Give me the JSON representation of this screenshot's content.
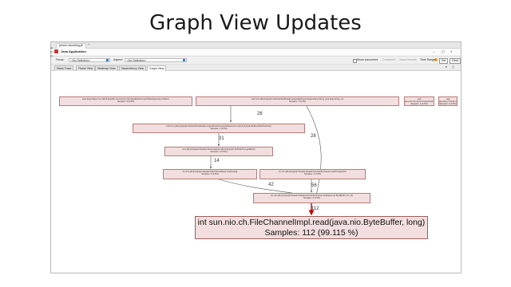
{
  "slide": {
    "title": "Graph View Updates"
  },
  "app": {
    "tab_title": "jvmcrc-recording.jfr",
    "tab_new": "+",
    "name": "Java Application",
    "window_controls": [
      "–",
      "▢",
      "×"
    ],
    "toolbar": {
      "focus_label": "Focus:",
      "focus_value": "<No Selection>",
      "aspect_label": "Aspect:",
      "aspect_value": "<No Selection>",
      "show_concurrent_label": "Show concurrent",
      "contained_label": "Contained",
      "same_threads_label": "Same threads",
      "time_range_label": "Time Range",
      "set_label": "Set",
      "clear_label": "Clear"
    },
    "view_tabs": [
      "Stack Trace",
      "Flame View",
      "Heatmap View",
      "Dependency View",
      "Graph View"
    ],
    "colors": {
      "node_fill": "#f2dede",
      "node_border": "#b97a7a",
      "highlight": "#c00000"
    }
  },
  "graph": {
    "nodes": [
      {
        "label": "java.lang.Object com.jdk.jfr.jfrgraph.concurrency.SimpleHttpServer.getObject(java.lang.Object)",
        "samples": "Samples: 3 (0.9%)"
      },
      {
        "label": "void com.jdk.jfr.jfrgraph.NetworkTextReader.writeHttpResponse(java.lang.String, java.lang.String, int)",
        "samples": "Samples: 1 (0.4%)"
      },
      {
        "label": "void java.util.concurrent.FutureTask.run()",
        "samples": "Samples: 2 (0.5%)"
      },
      {
        "label": "void java.lang.Thread.run()",
        "samples": "Samples: 2 (0.5%)"
      },
      {
        "label": "void com.jdk.jfr.jfrgraph.NetworkTextReader.LogicalTextProcessorWorker(com.jdk.jfr.jfrgraph.BufferedTextSubTree)",
        "samples": "Samples: 3 (0.9%)"
      },
      {
        "label": "com.jdk.jfr.jfrgraph.Reader.Slow.read(com.jdk.jfr.jfrgraph.TextSubTree.getBlock)",
        "samples": "Samples: 2 (0.6%)"
      },
      {
        "label": "int com.jdk.jfr.jfrgraph.Reader.FileChannelRead.read(byte[])",
        "samples": "Samples: 4 (3.5%)"
      },
      {
        "label": "int com.jdk.jfr.jfrgraph.Reader.ReaderAccessFileChannel.readUnsignedInt",
        "samples": "Samples: 4 (3.5%)"
      },
      {
        "label": "int com.jdk.jfr.jfrgraph.Reader.ReaderAccessFileChannel.read(java.nio.ByteBuffer, int, int)",
        "samples": "Samples: 4 (3.5%)"
      },
      {
        "label": "int sun.nio.ch.FileChannelImpl.read(java.nio.ByteBuffer, long)",
        "samples": "Samples: 112 (99.115 %)"
      }
    ],
    "edge_labels": [
      "26",
      "28",
      "31",
      "14",
      "42",
      "56",
      "112"
    ]
  }
}
